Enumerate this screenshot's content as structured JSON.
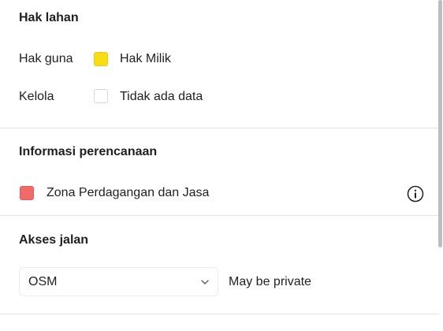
{
  "land_rights": {
    "title": "Hak lahan",
    "rows": [
      {
        "key": "Hak guna",
        "value": "Hak Milik",
        "swatch_color": "#f8dd14"
      },
      {
        "key": "Kelola",
        "value": "Tidak ada data",
        "swatch_color": "#ffffff"
      }
    ]
  },
  "planning": {
    "title": "Informasi perencanaan",
    "zone_label": "Zona Perdagangan dan Jasa",
    "zone_color": "#f06a6a",
    "info_icon": "info-circle-icon"
  },
  "road_access": {
    "title": "Akses jalan",
    "source_select": {
      "selected": "OSM"
    },
    "status": "May be private"
  },
  "colors": {
    "divider": "#e3e3e3",
    "scrollbar": "#bdbdbd"
  }
}
